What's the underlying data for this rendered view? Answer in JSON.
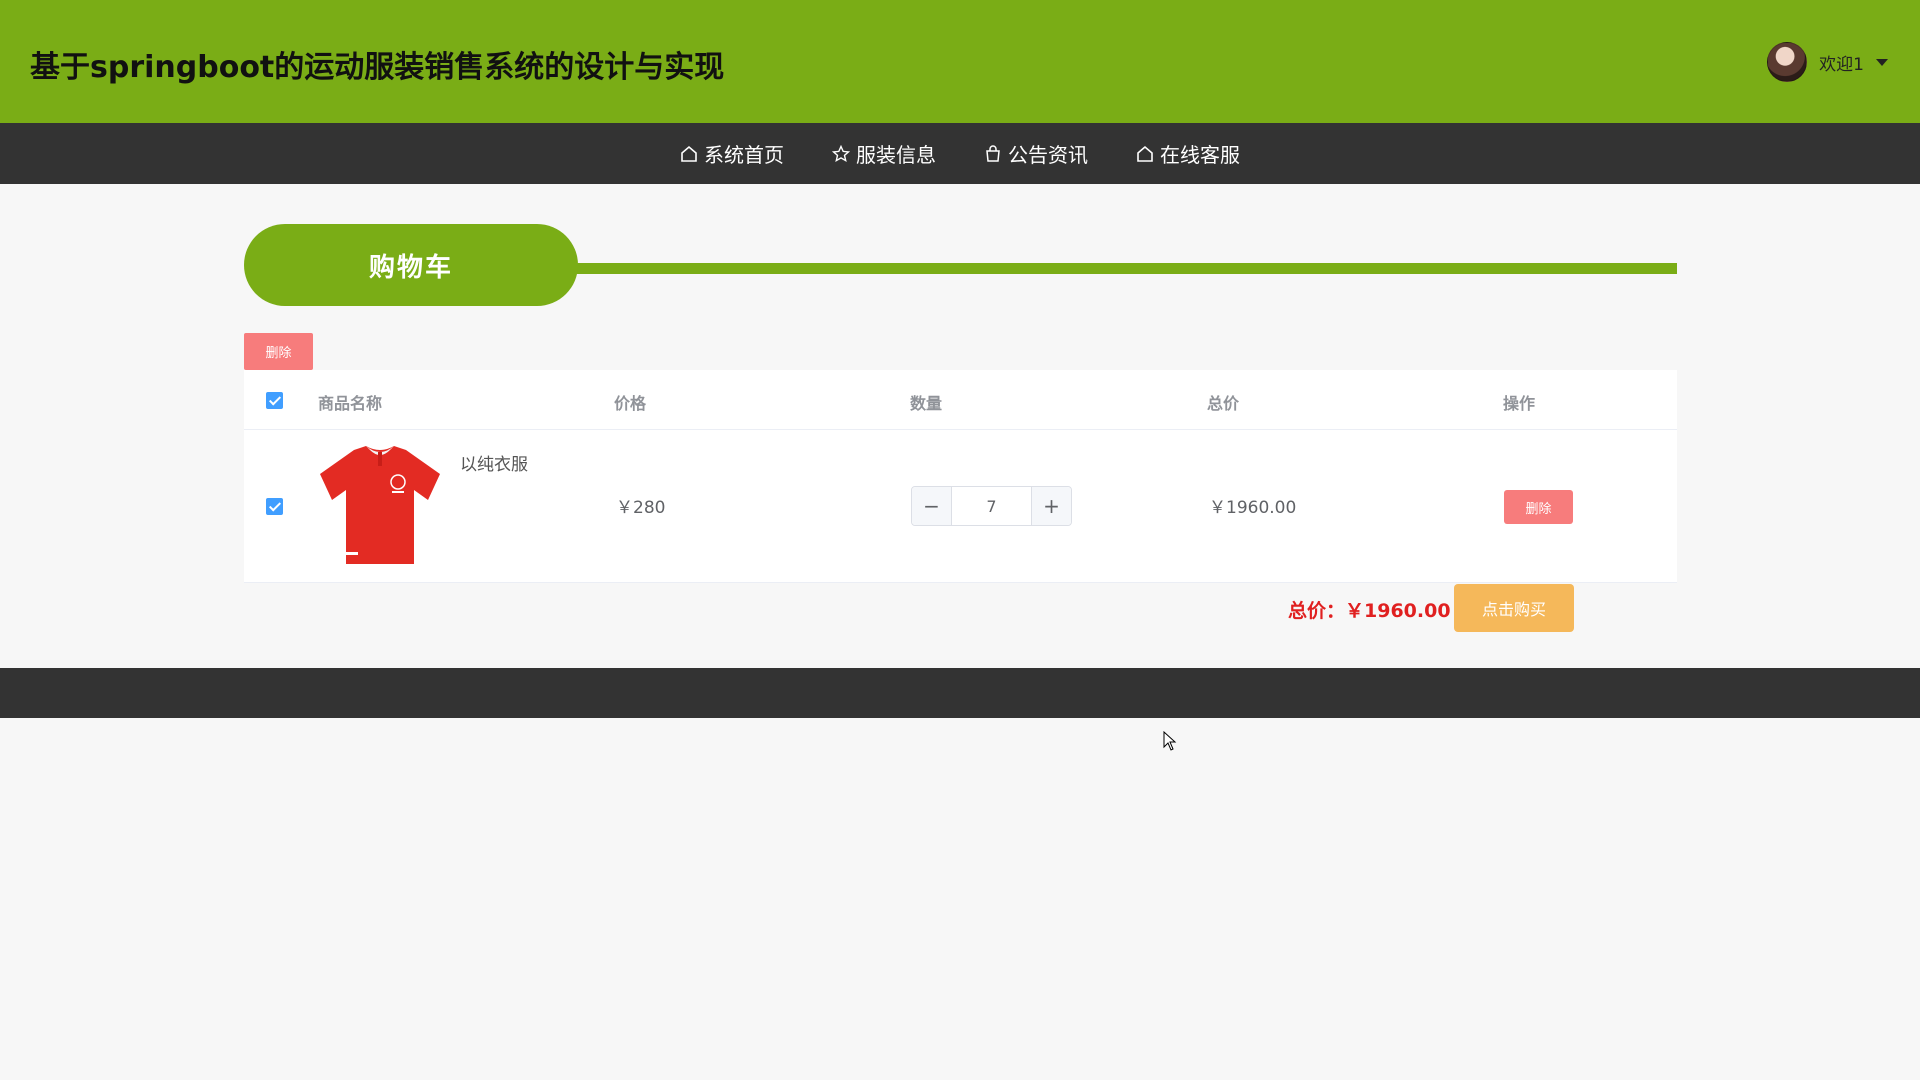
{
  "header": {
    "title": "基于springboot的运动服装销售系统的设计与实现",
    "user": {
      "greeting": "欢迎1",
      "avatar_icon": "user-avatar",
      "dropdown_icon": "caret-down-icon"
    }
  },
  "nav": {
    "items": [
      {
        "label": "系统首页",
        "icon": "home-icon"
      },
      {
        "label": "服装信息",
        "icon": "star-icon"
      },
      {
        "label": "公告资讯",
        "icon": "bag-icon"
      },
      {
        "label": "在线客服",
        "icon": "home-icon"
      }
    ]
  },
  "section": {
    "title": "购物车"
  },
  "toolbar": {
    "delete_label": "删除"
  },
  "table": {
    "headers": [
      "商品名称",
      "价格",
      "数量",
      "总价",
      "操作"
    ],
    "rows": [
      {
        "checked": true,
        "name": "以纯衣服",
        "price": "￥280",
        "quantity": "7",
        "total": "￥1960.00",
        "action_label": "删除",
        "image_desc": "red-polo-shirt"
      }
    ],
    "select_all_checked": true
  },
  "summary": {
    "total_text": "总价：￥1960.00",
    "buy_label": "点击购买"
  },
  "colors": {
    "brand_green": "#7aad16",
    "nav_dark": "#333333",
    "danger": "#f77c7c",
    "warning": "#f5b85a",
    "price_red": "#e02020",
    "checkbox_blue": "#409eff"
  }
}
